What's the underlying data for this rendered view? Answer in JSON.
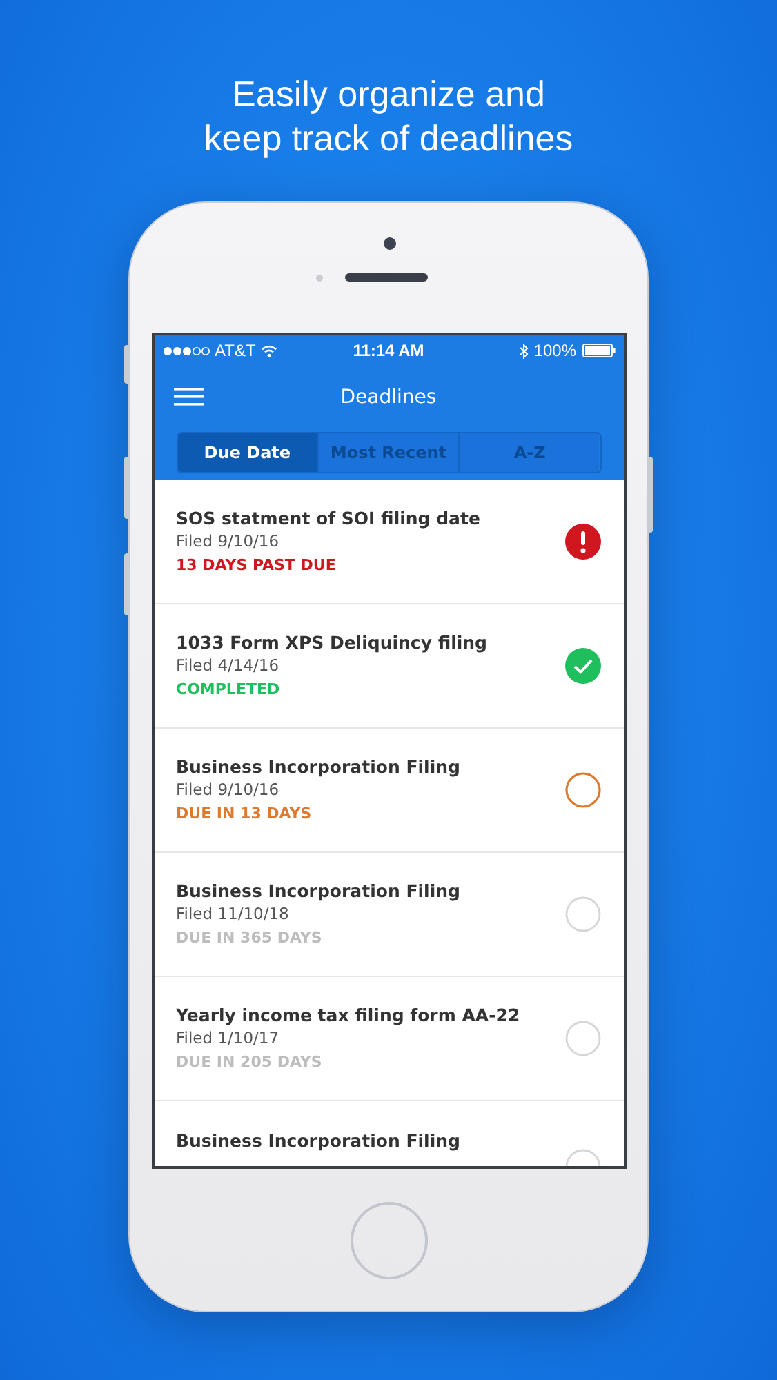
{
  "headline": [
    "Easily organize and",
    "keep track of deadlines"
  ],
  "status_bar": {
    "carrier": "AT&T",
    "time": "11:14 AM",
    "battery": "100%"
  },
  "nav": {
    "title": "Deadlines"
  },
  "tabs": [
    {
      "label": "Due Date",
      "selected": true
    },
    {
      "label": "Most Recent",
      "selected": false
    },
    {
      "label": "A-Z",
      "selected": false
    }
  ],
  "deadlines": [
    {
      "title": "SOS statment of SOI filing date",
      "filed": "Filed 9/10/16",
      "status": "13 DAYS PAST DUE",
      "kind": "overdue"
    },
    {
      "title": "1033 Form XPS Deliquincy filing",
      "filed": "Filed 4/14/16",
      "status": "COMPLETED",
      "kind": "completed"
    },
    {
      "title": "Business Incorporation Filing",
      "filed": "Filed 9/10/16",
      "status": "DUE IN 13 DAYS",
      "kind": "due_soon"
    },
    {
      "title": "Business Incorporation Filing",
      "filed": "Filed 11/10/18",
      "status": "DUE IN 365 DAYS",
      "kind": "upcoming"
    },
    {
      "title": "Yearly income tax filing form AA-22",
      "filed": "Filed 1/10/17",
      "status": "DUE IN 205 DAYS",
      "kind": "upcoming"
    },
    {
      "title": "Business Incorporation Filing",
      "kind": "upcoming"
    }
  ]
}
